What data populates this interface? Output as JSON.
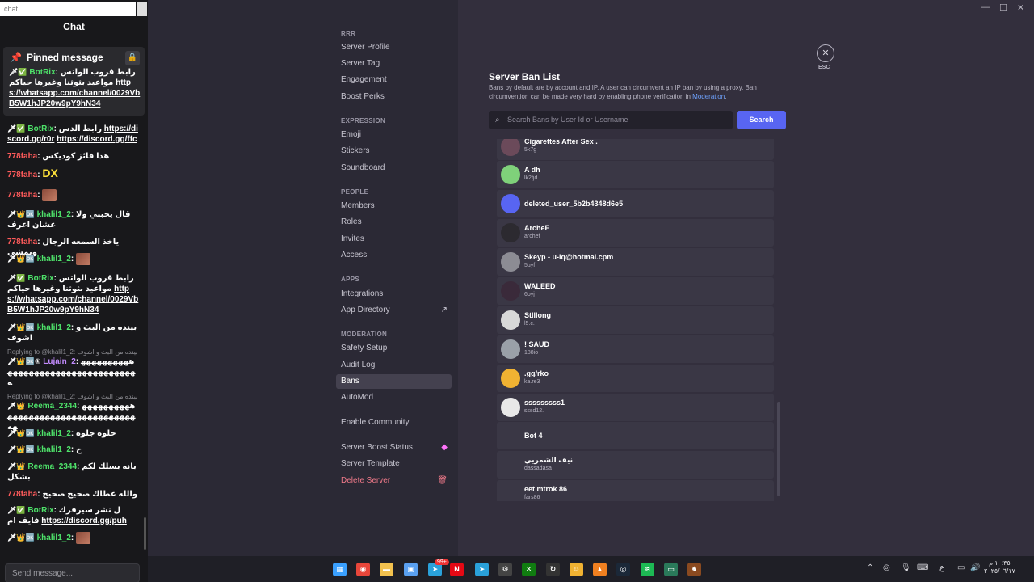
{
  "chat": {
    "search_text": "chat",
    "title": "Chat",
    "pinned": {
      "header": "Pinned message",
      "user": "BotRix",
      "text": "رابط قروب الواتس مواعيد بثوثنا وغيرها حياكم",
      "link": "https://whatsapp.com/channel/0029VbB5W1hJP20w9pY9hN34"
    },
    "messages": [
      {
        "user": "BotRix",
        "text": "رابط الدس",
        "link1": "https://discord.gg/r0r",
        "link2": "https://discord.gg/ffc"
      },
      {
        "user": "778faha",
        "text": "هذا فائز كوديكس"
      },
      {
        "user": "778faha",
        "text": "DX"
      },
      {
        "user": "778faha",
        "text": ""
      },
      {
        "user": "khalil1_2",
        "text": "قال يحبني ولا عشان اعرف"
      },
      {
        "user": "778faha",
        "text": "ياخذ السمعه الرجال ويمشي"
      },
      {
        "user": "khalil1_2",
        "text": ""
      },
      {
        "user": "BotRix",
        "text": "رابط قروب الواتس مواعيد بثوثنا وغيرها حياكم",
        "link": "https://whatsapp.com/channel/0029VbB5W1hJP20w9pY9hN34"
      },
      {
        "user": "khalil1_2",
        "text": "بينده من البث و اشوف"
      },
      {
        "reply": "Replying to @khalil1_2: بينده من البث و اشوف"
      },
      {
        "user": "Lujain_2",
        "text": "ههههههههههههههههههههههههههههههههههه"
      },
      {
        "reply": "Replying to @khalil1_2: بينده من البث و اشوف"
      },
      {
        "user": "Reema_2344",
        "text": "هههههههههههههههههههههههههههههههههههه"
      },
      {
        "user": "khalil1_2",
        "text": "حلوه جلوه"
      },
      {
        "user": "khalil1_2",
        "text": "ح"
      },
      {
        "user": "Reema_2344",
        "text": "يانه يسلك لكم بشكل"
      },
      {
        "user": "778faha",
        "text": "والله عطاك صحيح صحيح"
      },
      {
        "user": "BotRix",
        "text": "ل نشر سيرفرك فايف ام",
        "link": "https://discord.gg/puh"
      },
      {
        "user": "khalil1_2",
        "text": ""
      }
    ],
    "send_placeholder": "Send message..."
  },
  "window": {
    "controls": [
      "—",
      "☐",
      "✕"
    ]
  },
  "nav": {
    "server_name": "RRR",
    "items_top": [
      "Server Profile",
      "Server Tag",
      "Engagement",
      "Boost Perks"
    ],
    "expression_label": "EXPRESSION",
    "expression": [
      "Emoji",
      "Stickers",
      "Soundboard"
    ],
    "people_label": "PEOPLE",
    "people": [
      "Members",
      "Roles",
      "Invites",
      "Access"
    ],
    "apps_label": "APPS",
    "apps": [
      "Integrations",
      "App Directory"
    ],
    "moderation_label": "MODERATION",
    "moderation": [
      "Safety Setup",
      "Audit Log",
      "Bans",
      "AutoMod"
    ],
    "enable_community": "Enable Community",
    "bottom": [
      "Server Boost Status",
      "Server Template",
      "Delete Server"
    ]
  },
  "bans": {
    "title": "Server Ban List",
    "desc_pre": "Bans by default are by account and IP. A user can circumvent an IP ban by using a proxy. Ban circumvention can be made very hard by enabling phone verification in ",
    "desc_link": "Moderation",
    "desc_post": ".",
    "search_placeholder": "Search Bans by User Id or Username",
    "search_button": "Search",
    "close_label": "ESC",
    "rows": [
      {
        "name": "Cigarettes After Sex .",
        "sub": "5k7g",
        "avatar": "#6b4a5a"
      },
      {
        "name": "A dh",
        "sub": "lk2fjd",
        "avatar": "#7fd17a"
      },
      {
        "name": "deleted_user_5b2b4348d6e5",
        "sub": "",
        "avatar": "#5865f2"
      },
      {
        "name": "ArcheF",
        "sub": "archef",
        "avatar": "#2c2a30"
      },
      {
        "name": "Skeyp - u-iq@hotmai.cpm",
        "sub": "5uyf",
        "avatar": "#8c8c94"
      },
      {
        "name": "WALEED",
        "sub": "6oyj",
        "avatar": "#3a2a3a"
      },
      {
        "name": "Stlllong",
        "sub": "l5.c.",
        "avatar": "#d8d8d8"
      },
      {
        "name": "! SAUD",
        "sub": "188io",
        "avatar": "#9aa0a8"
      },
      {
        "name": ".gg/rko",
        "sub": "ka.re3",
        "avatar": "#f0b232"
      },
      {
        "name": "sssssssss1",
        "sub": "sssd12.",
        "avatar": "#e8e8e8"
      },
      {
        "name": "Bot 4",
        "sub": "",
        "avatar": ""
      },
      {
        "name": "نيف الشمريي",
        "sub": "dassadasa",
        "avatar": ""
      },
      {
        "name": "eet mtrok 86",
        "sub": "fars86",
        "avatar": ""
      }
    ]
  },
  "taskbar": {
    "icons": [
      {
        "name": "windows-icon",
        "color": "#3aa0ff",
        "glyph": "▦"
      },
      {
        "name": "chrome-icon",
        "color": "#e8463a",
        "glyph": "◉"
      },
      {
        "name": "explorer-icon",
        "color": "#f2c14e",
        "glyph": "▬"
      },
      {
        "name": "store-icon",
        "color": "#5aa0f0",
        "glyph": "▣"
      },
      {
        "name": "telegram-badge-icon",
        "color": "#2aa1da",
        "glyph": "➤"
      },
      {
        "name": "netflix-icon",
        "color": "#e50914",
        "glyph": "N"
      },
      {
        "name": "telegram-icon",
        "color": "#2aa1da",
        "glyph": "➤"
      },
      {
        "name": "settings-icon",
        "color": "#444",
        "glyph": "⚙"
      },
      {
        "name": "xbox-icon",
        "color": "#107c10",
        "glyph": "✕"
      },
      {
        "name": "sync-icon",
        "color": "#333",
        "glyph": "↻"
      },
      {
        "name": "discord-app-icon",
        "color": "#f0b232",
        "glyph": "☺"
      },
      {
        "name": "vlc-icon",
        "color": "#f08020",
        "glyph": "▲"
      },
      {
        "name": "steam-icon",
        "color": "#1b2838",
        "glyph": "◎"
      },
      {
        "name": "spotify-icon",
        "color": "#1db954",
        "glyph": "≋"
      },
      {
        "name": "app-icon",
        "color": "#2a7a5a",
        "glyph": "▭"
      },
      {
        "name": "game-icon",
        "color": "#8a4a20",
        "glyph": "♞"
      }
    ],
    "badge_count": "99+",
    "clock_time": "١٠:٣٥ م",
    "clock_date": "٢٠٢٥/٠٦/١٧",
    "lang": "ع"
  }
}
